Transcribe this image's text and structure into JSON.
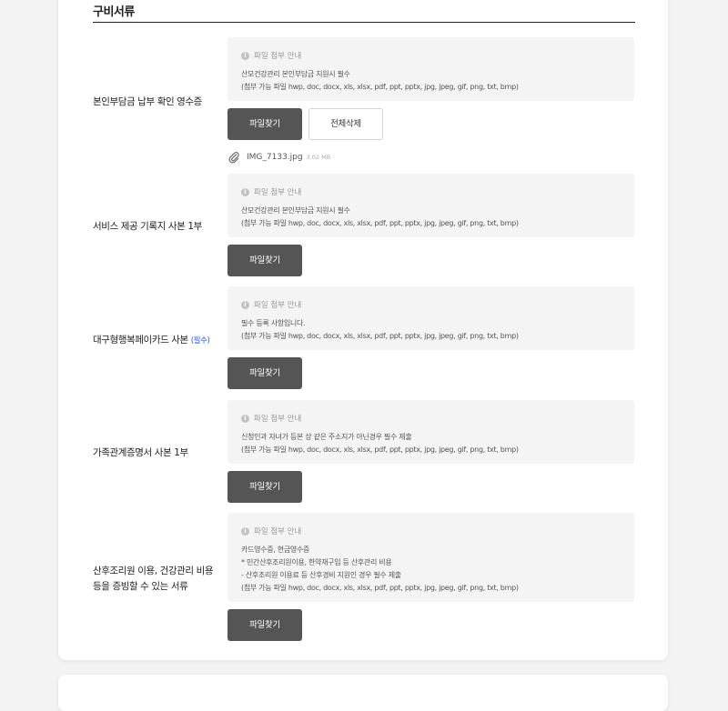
{
  "section": {
    "title": "구비서류"
  },
  "info_header": "파일 첨부 안내",
  "buttons": {
    "find": "파일찾기",
    "delete_all": "전체삭제"
  },
  "rows": [
    {
      "label": "본인부담금 납부 확인 영수증",
      "lines": [
        "산모건강관리 본인부담금 지원시 필수",
        "(첨부 가능 파일 hwp, doc, docx, xls, xlsx, pdf, ppt, pptx, jpg, jpeg, gif, png, txt, bmp)"
      ],
      "file": {
        "name": "IMG_7133.jpg",
        "size": "3.02 MB"
      }
    },
    {
      "label": "서비스 제공 기록지 사본 1부",
      "lines": [
        "산모건강관리 본인부담금 지원시 필수",
        "(첨부 가능 파일 hwp, doc, docx, xls, xlsx, pdf, ppt, pptx, jpg, jpeg, gif, png, txt, bmp)"
      ]
    },
    {
      "label": "대구형행복페이카드 사본",
      "required": "(필수)",
      "lines": [
        "필수 등록 사항입니다.",
        "(첨부 가능 파일 hwp, doc, docx, xls, xlsx, pdf, ppt, pptx, jpg, jpeg, gif, png, txt, bmp)"
      ]
    },
    {
      "label": "가족관계증명서 사본 1부",
      "lines": [
        "신청인과 자녀가 등본 상 같은 주소지가 아닌경우 필수 제출",
        "(첨부 가능 파일 hwp, doc, docx, xls, xlsx, pdf, ppt, pptx, jpg, jpeg, gif, png, txt, bmp)"
      ]
    },
    {
      "label_line1": "산후조리원 이용, 건강관리 비용",
      "label_line2": "등을 증빙할 수 있는 서류",
      "lines": [
        "카드영수증, 현금영수증",
        "* 민간산후조리원이용, 한약재구입 등 산후관리 비용",
        "- 산후조리원 이용료 등 산후경비 지원인 경우 필수 제출",
        "(첨부 가능 파일 hwp, doc, docx, xls, xlsx, pdf, ppt, pptx, jpg, jpeg, gif, png, txt, bmp)"
      ]
    }
  ]
}
